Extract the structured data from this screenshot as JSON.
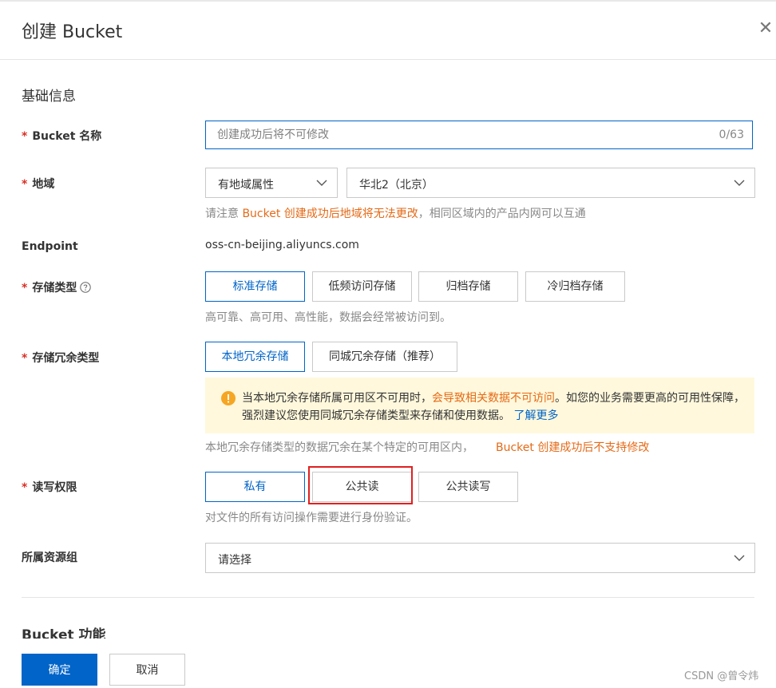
{
  "dialog": {
    "title": "创建 Bucket",
    "close_icon": "close-icon"
  },
  "basic_section": {
    "title": "基础信息"
  },
  "bucket_name": {
    "label": "Bucket 名称",
    "required_mark": "*",
    "placeholder": "创建成功后将不可修改",
    "value": "",
    "counter": "0/63"
  },
  "region": {
    "label": "地域",
    "required_mark": "*",
    "attribute_select": "有地域属性",
    "region_select": "华北2（北京）",
    "hint_prefix": "请注意 ",
    "hint_highlight": "Bucket 创建成功后地域将无法更改",
    "hint_suffix": "，相同区域内的产品内网可以互通"
  },
  "endpoint": {
    "label": "Endpoint",
    "value": "oss-cn-beijing.aliyuncs.com"
  },
  "storage_class": {
    "label": "存储类型",
    "required_mark": "*",
    "help_icon": "question-circle-icon",
    "options": [
      "标准存储",
      "低频访问存储",
      "归档存储",
      "冷归档存储"
    ],
    "selected": "标准存储",
    "hint": "高可靠、高可用、高性能，数据会经常被访问到。"
  },
  "redundancy": {
    "label": "存储冗余类型",
    "required_mark": "*",
    "options": [
      "本地冗余存储",
      "同城冗余存储（推荐）"
    ],
    "selected": "本地冗余存储",
    "notice_icon": "warning-icon",
    "notice_part1": "当本地冗余存储所属可用区不可用时，",
    "notice_highlight": "会导致相关数据不可访问",
    "notice_part2": "。如您的业务需要更高的可用性保障，强烈建议您使用同城冗余存储类型来存储和使用数据。",
    "notice_link": "了解更多",
    "hint": "本地冗余存储类型的数据冗余在某个特定的可用区内，",
    "hint_highlight": "Bucket 创建成功后不支持修改"
  },
  "acl": {
    "label": "读写权限",
    "required_mark": "*",
    "options": [
      "私有",
      "公共读",
      "公共读写"
    ],
    "selected": "私有",
    "hint": "对文件的所有访问操作需要进行身份验证。"
  },
  "resource_group": {
    "label": "所属资源组",
    "placeholder": "请选择"
  },
  "features_section": {
    "title": "Bucket 功能"
  },
  "footer": {
    "confirm": "确定",
    "cancel": "取消"
  },
  "watermark": "CSDN @曾令炜",
  "colors": {
    "primary": "#0064c8",
    "warning": "#e56a17",
    "required": "#d93026",
    "highlight_box": "#e02020"
  }
}
